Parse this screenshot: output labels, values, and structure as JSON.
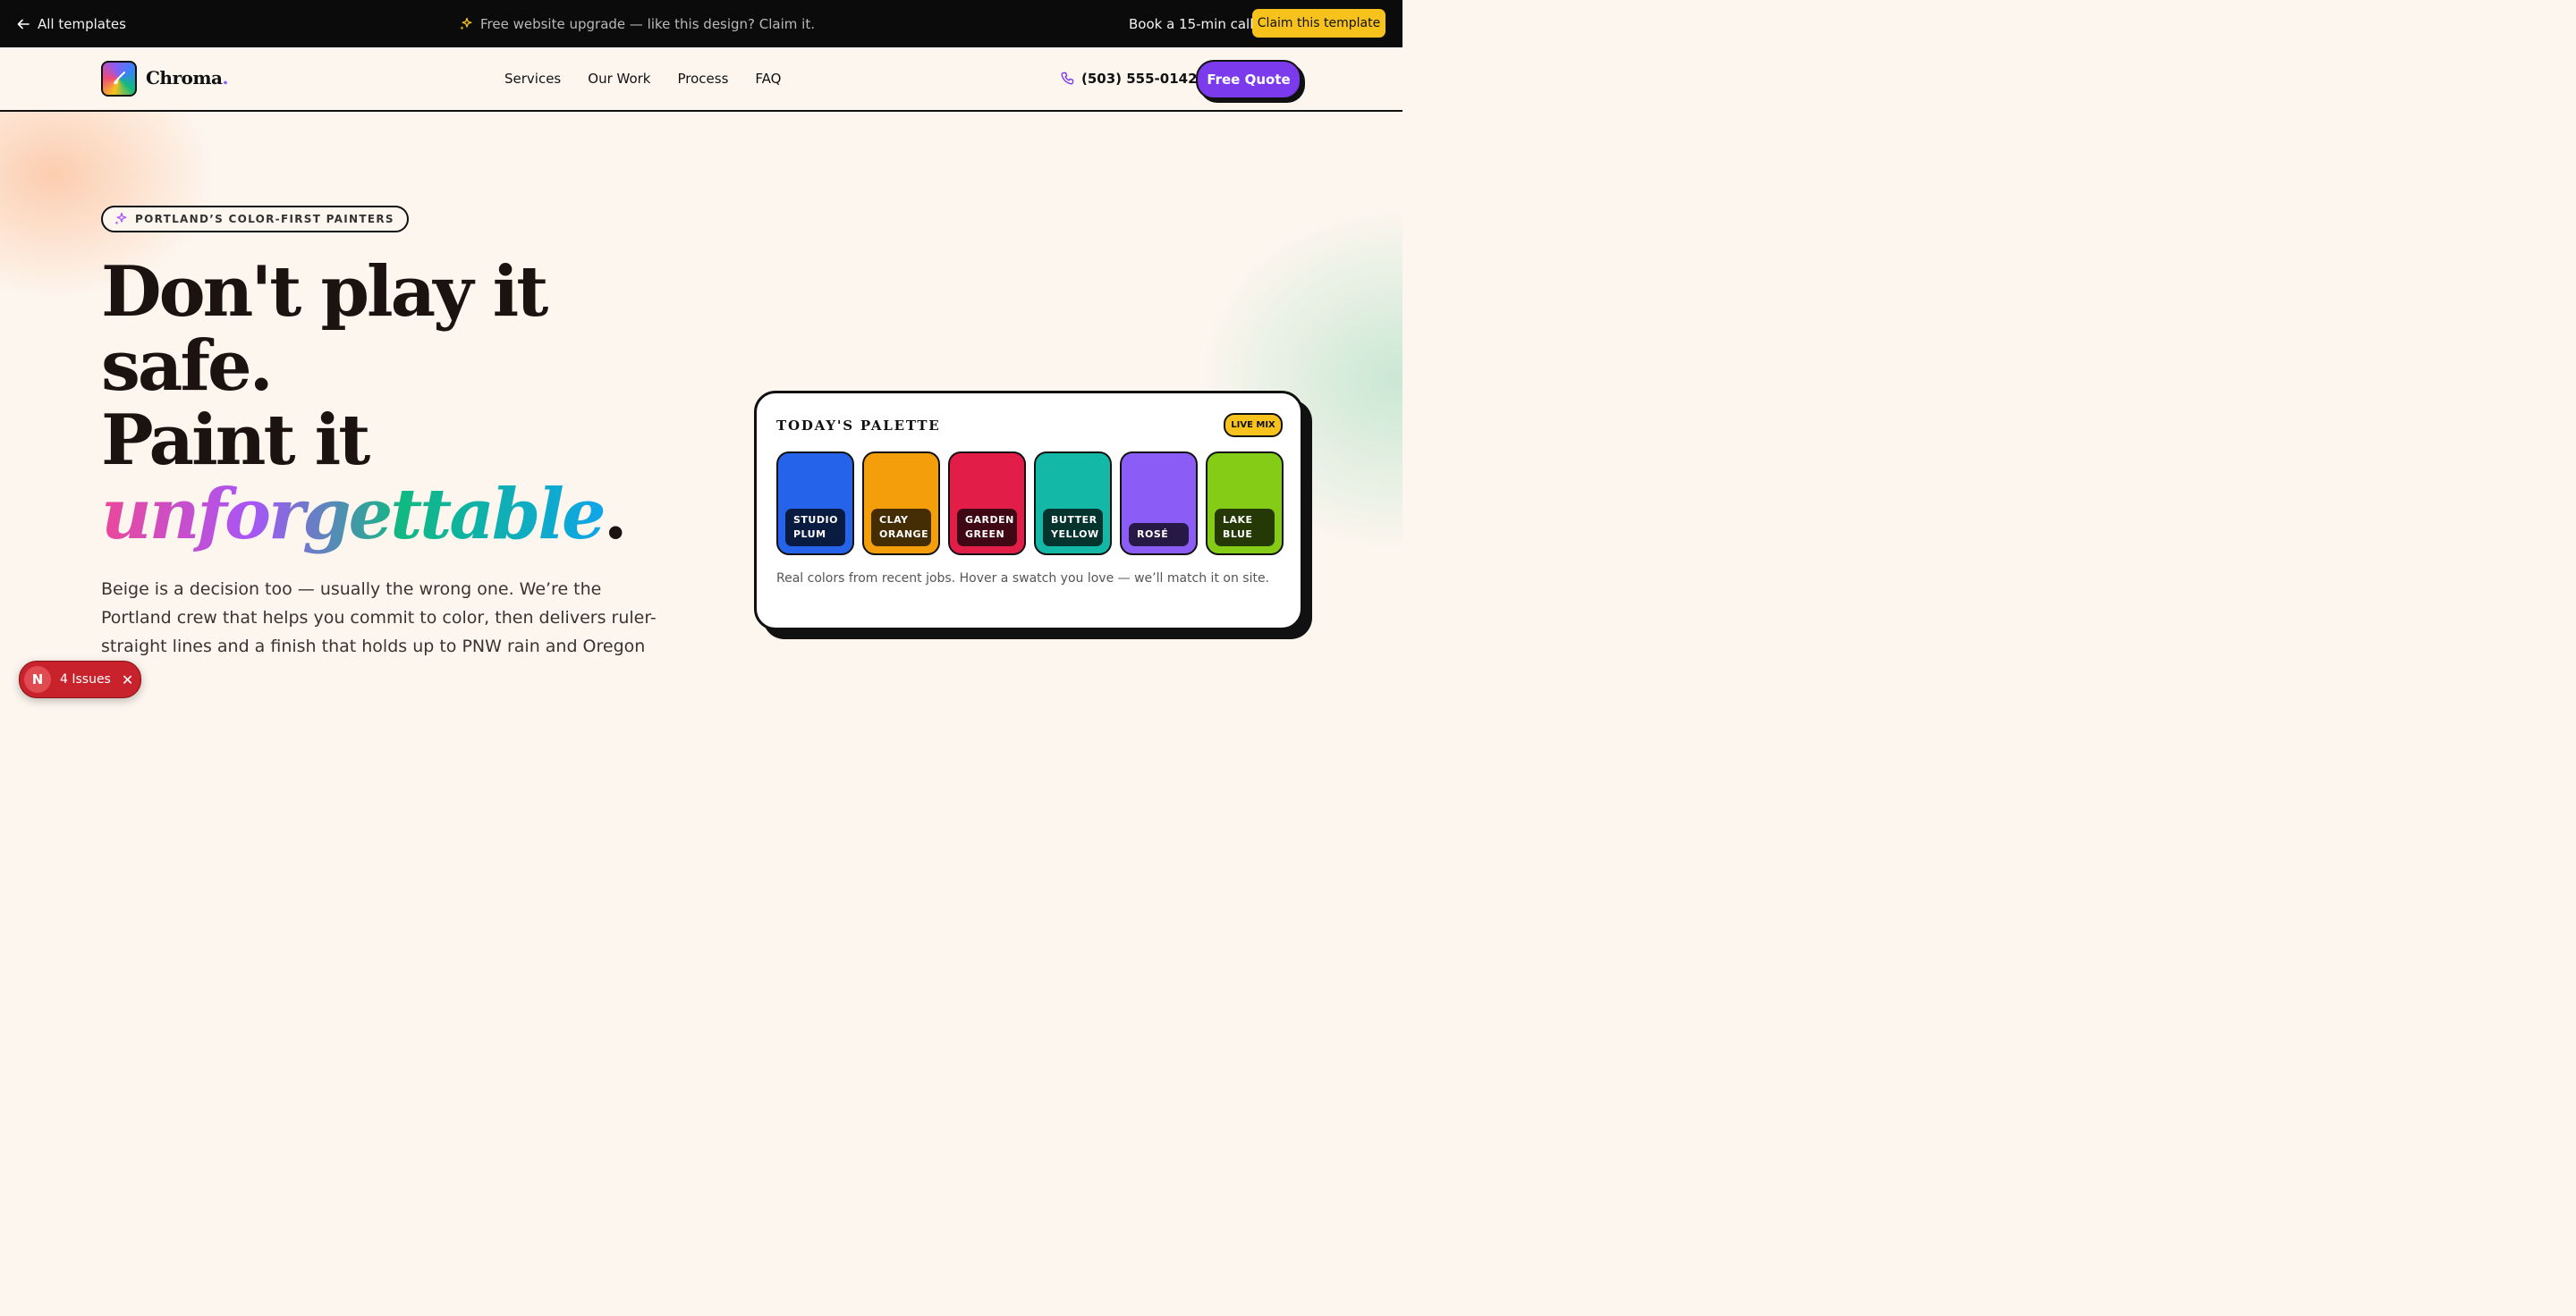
{
  "topbar": {
    "back_label": "All templates",
    "promo_text": "Free website upgrade — like this design? Claim it.",
    "call_label": "Book a 15-min call",
    "claim_label": "Claim this template"
  },
  "nav": {
    "brand": "Chroma",
    "brand_dot": ".",
    "links": [
      "Services",
      "Our Work",
      "Process",
      "FAQ"
    ],
    "phone": "(503) 555-0142",
    "cta": "Free Quote"
  },
  "hero": {
    "eyebrow": "PORTLAND’S COLOR-FIRST PAINTERS",
    "headline_line1": "Don't play it",
    "headline_line2": "safe.",
    "headline_line3": "Paint it",
    "headline_accent": "unforgettable",
    "headline_end": ".",
    "lead": "Beige is a decision too — usually the wrong one. We’re the Portland crew that helps you commit to color, then delivers ruler-straight lines and a finish that holds up to PNW rain and Oregon"
  },
  "palette": {
    "title": "TODAY'S PALETTE",
    "badge": "LIVE MIX",
    "swatches": [
      {
        "line1": "STUDIO",
        "line2": "PLUM",
        "color": "#2563eb"
      },
      {
        "line1": "CLAY",
        "line2": "ORANGE",
        "color": "#f59e0b"
      },
      {
        "line1": "GARDEN",
        "line2": "GREEN",
        "color": "#e11d48"
      },
      {
        "line1": "BUTTER",
        "line2": "YELLOW",
        "color": "#14b8a6"
      },
      {
        "line1": "ROSÉ",
        "line2": "",
        "color": "#8b5cf6"
      },
      {
        "line1": "LAKE",
        "line2": "BLUE",
        "color": "#84cc16"
      }
    ],
    "note": "Real colors from recent jobs. Hover a swatch you love — we’ll match it on site."
  },
  "issues_badge": {
    "letter": "N",
    "label": "4 Issues"
  },
  "colors": {
    "accent": "#7c3aed",
    "highlight": "#f8c21c",
    "background": "#fdf6ef"
  }
}
